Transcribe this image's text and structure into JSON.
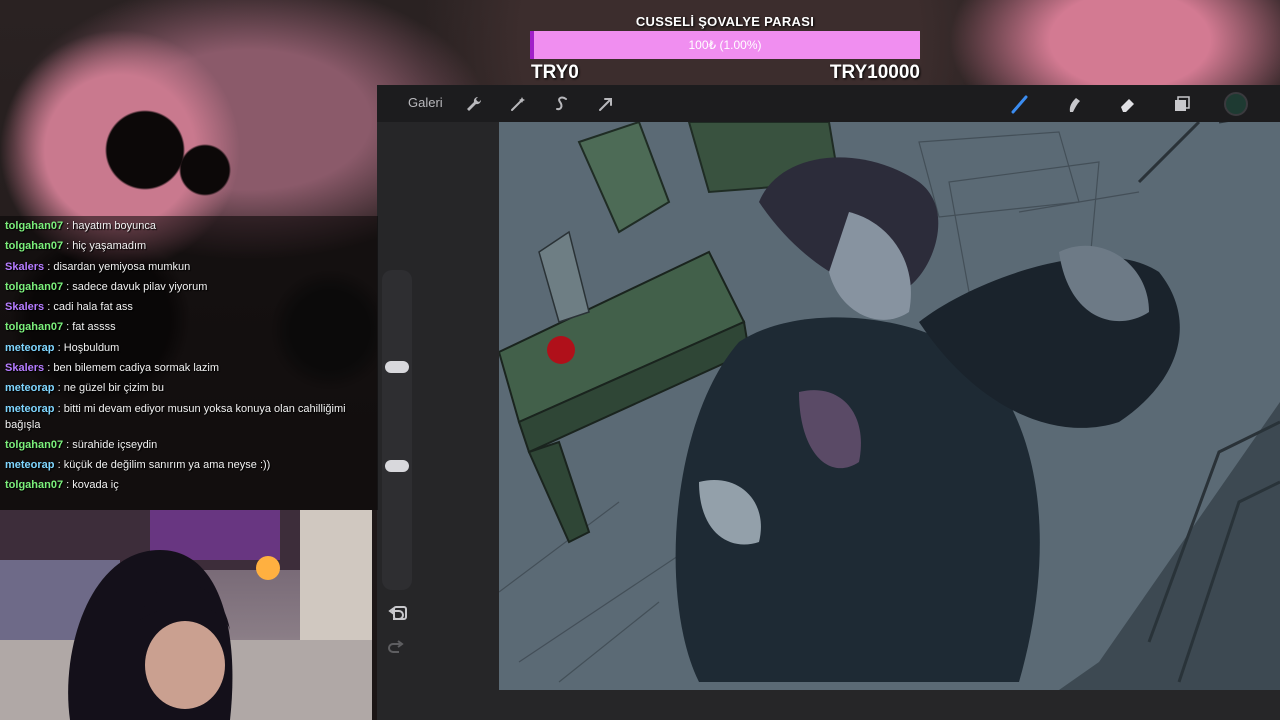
{
  "donation_goal": {
    "title": "CUSSELİ ŞOVALYE PARASI",
    "progress_label": "100₺ (1.00%)",
    "progress_percent": 1.0,
    "min_label": "TRY0",
    "max_label": "TRY10000",
    "bar_color": "#f08ef0",
    "fill_color": "#a020c8"
  },
  "toolbar": {
    "gallery_label": "Galeri",
    "left_icons": [
      "wrench-icon",
      "magic-wand-icon",
      "selection-s-icon",
      "transform-arrow-icon"
    ],
    "right_icons": [
      "brush-icon",
      "smudge-icon",
      "eraser-icon",
      "layers-icon",
      "color-swatch-icon"
    ],
    "active_color": "#1e3a32",
    "brush_color": "#3b8cf0"
  },
  "chat": {
    "messages": [
      {
        "user": "tolgahan07",
        "color": "#7cf07c",
        "text": "hayatım boyunca"
      },
      {
        "user": "tolgahan07",
        "color": "#7cf07c",
        "text": "hiç yaşamadım"
      },
      {
        "user": "Skalers",
        "color": "#b57cff",
        "text": "disardan yemiyosa mumkun"
      },
      {
        "user": "tolgahan07",
        "color": "#7cf07c",
        "text": "sadece davuk pilav yiyorum"
      },
      {
        "user": "Skalers",
        "color": "#b57cff",
        "text": "cadi hala fat ass"
      },
      {
        "user": "tolgahan07",
        "color": "#7cf07c",
        "text": "fat assss"
      },
      {
        "user": "meteorap",
        "color": "#7fd6ff",
        "text": "Hoşbuldum"
      },
      {
        "user": "Skalers",
        "color": "#b57cff",
        "text": "ben bilemem cadiya sormak lazim"
      },
      {
        "user": "meteorap",
        "color": "#7fd6ff",
        "text": "ne güzel bir çizim bu"
      },
      {
        "user": "meteorap",
        "color": "#7fd6ff",
        "text": "bitti mi devam ediyor musun yoksa konuya olan cahilliğimi bağışla"
      },
      {
        "user": "tolgahan07",
        "color": "#7cf07c",
        "text": "sürahide içseydin"
      },
      {
        "user": "meteorap",
        "color": "#7fd6ff",
        "text": "küçük de değilim sanırım ya ama neyse :))"
      },
      {
        "user": "tolgahan07",
        "color": "#7cf07c",
        "text": "kovada iç"
      }
    ]
  }
}
